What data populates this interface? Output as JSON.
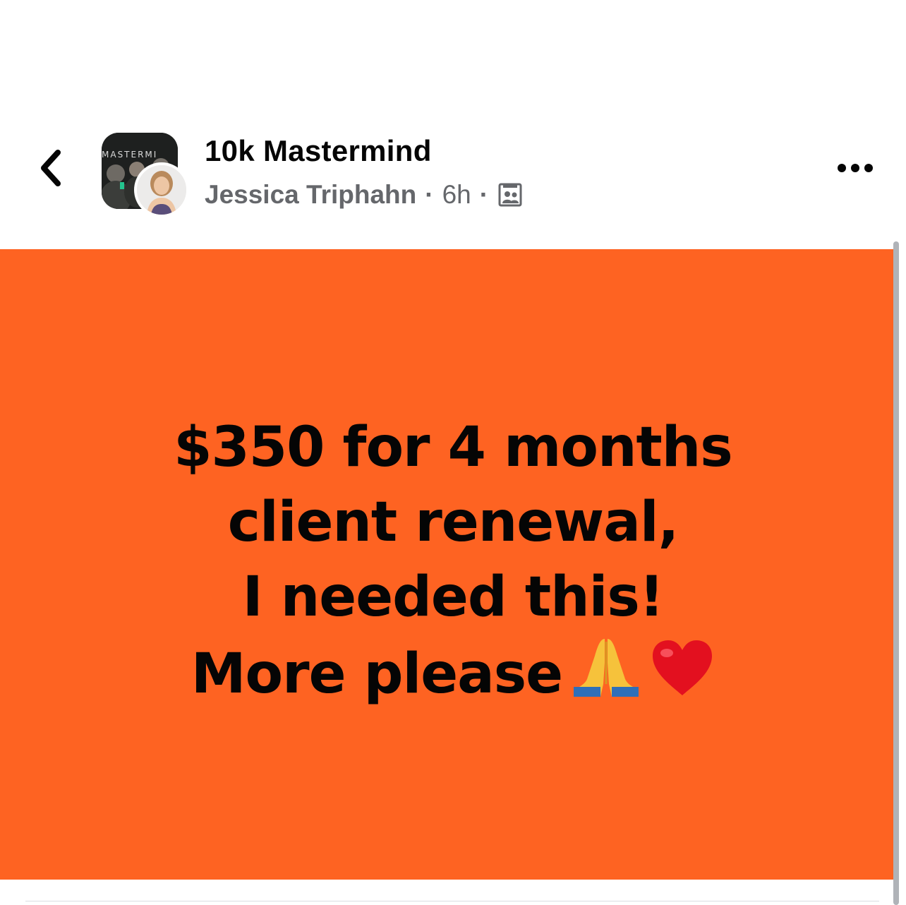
{
  "header": {
    "group_name": "10k Mastermind",
    "group_avatar_text": "MASTERMI",
    "author": "Jessica Triphahn",
    "separator": "·",
    "time": "6h",
    "audience_icon": "group-audience-icon"
  },
  "post": {
    "background_color": "#fe6322",
    "lines": [
      "$350 for 4 months",
      "client renewal,",
      "I needed this!",
      "More please"
    ],
    "emojis": [
      "folded-hands-icon",
      "red-heart-icon"
    ]
  },
  "icons": {
    "back": "chevron-left-icon",
    "more": "more-horizontal-icon"
  }
}
